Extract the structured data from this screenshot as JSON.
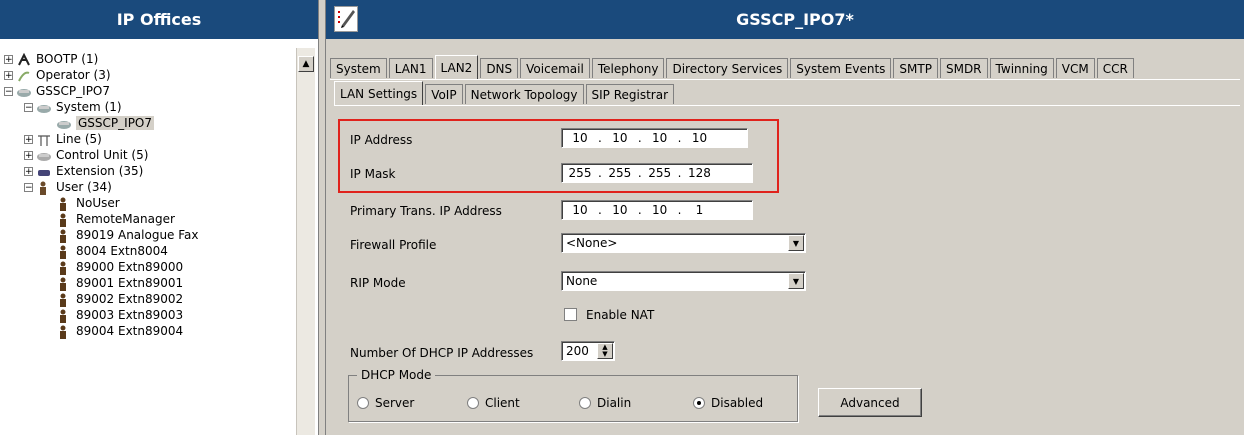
{
  "left_panel": {
    "title": "IP Offices",
    "tree": [
      {
        "label": "BOOTP (1)",
        "icon": "bootp-icon",
        "expander": "+",
        "indent": 0
      },
      {
        "label": "Operator (3)",
        "icon": "operator-icon",
        "expander": "+",
        "indent": 0
      },
      {
        "label": "GSSCP_IPO7",
        "icon": "ip-office-icon",
        "expander": "−",
        "indent": 0
      },
      {
        "label": "System (1)",
        "icon": "system-icon",
        "expander": "−",
        "indent": 1
      },
      {
        "label": "GSSCP_IPO7",
        "icon": "system-unit-icon",
        "expander": "",
        "indent": 2,
        "selected": true
      },
      {
        "label": "Line (5)",
        "icon": "line-icon",
        "expander": "+",
        "indent": 1
      },
      {
        "label": "Control Unit (5)",
        "icon": "control-unit-icon",
        "expander": "+",
        "indent": 1
      },
      {
        "label": "Extension (35)",
        "icon": "extension-icon",
        "expander": "+",
        "indent": 1
      },
      {
        "label": "User (34)",
        "icon": "user-group-icon",
        "expander": "−",
        "indent": 1
      },
      {
        "label": "NoUser",
        "icon": "user-icon",
        "expander": "",
        "indent": 2
      },
      {
        "label": "RemoteManager",
        "icon": "user-icon",
        "expander": "",
        "indent": 2
      },
      {
        "label": "89019 Analogue Fax",
        "icon": "user-icon",
        "expander": "",
        "indent": 2
      },
      {
        "label": "8004 Extn8004",
        "icon": "user-icon",
        "expander": "",
        "indent": 2
      },
      {
        "label": "89000 Extn89000",
        "icon": "user-icon",
        "expander": "",
        "indent": 2
      },
      {
        "label": "89001 Extn89001",
        "icon": "user-icon",
        "expander": "",
        "indent": 2
      },
      {
        "label": "89002 Extn89002",
        "icon": "user-icon",
        "expander": "",
        "indent": 2
      },
      {
        "label": "89003 Extn89003",
        "icon": "user-icon",
        "expander": "",
        "indent": 2
      },
      {
        "label": "89004 Extn89004",
        "icon": "user-icon",
        "expander": "",
        "indent": 2
      }
    ]
  },
  "right_panel": {
    "title": "GSSCP_IPO7*",
    "top_tabs": [
      "System",
      "LAN1",
      "LAN2",
      "DNS",
      "Voicemail",
      "Telephony",
      "Directory Services",
      "System Events",
      "SMTP",
      "SMDR",
      "Twinning",
      "VCM",
      "CCR"
    ],
    "active_top_tab": "LAN2",
    "sub_tabs": [
      "LAN Settings",
      "VoIP",
      "Network Topology",
      "SIP Registrar"
    ],
    "active_sub_tab": "LAN Settings",
    "fields": {
      "ip_address": {
        "label": "IP Address",
        "octets": [
          "10",
          "10",
          "10",
          "10"
        ]
      },
      "ip_mask": {
        "label": "IP Mask",
        "octets": [
          "255",
          "255",
          "255",
          "128"
        ]
      },
      "primary_trans_ip": {
        "label": "Primary Trans. IP Address",
        "octets": [
          "10",
          "10",
          "10",
          "1"
        ]
      },
      "firewall_profile": {
        "label": "Firewall Profile",
        "value": "<None>"
      },
      "rip_mode": {
        "label": "RIP Mode",
        "value": "None"
      },
      "enable_nat": {
        "label": "Enable NAT",
        "checked": false
      },
      "dhcp_count": {
        "label": "Number Of DHCP IP Addresses",
        "value": "200"
      },
      "dhcp_mode": {
        "label": "DHCP Mode",
        "options": [
          "Server",
          "Client",
          "Dialin",
          "Disabled"
        ],
        "selected": "Disabled"
      },
      "advanced_button": "Advanced"
    },
    "highlight_color": "#e0231d",
    "header_color": "#1a4a7c"
  }
}
